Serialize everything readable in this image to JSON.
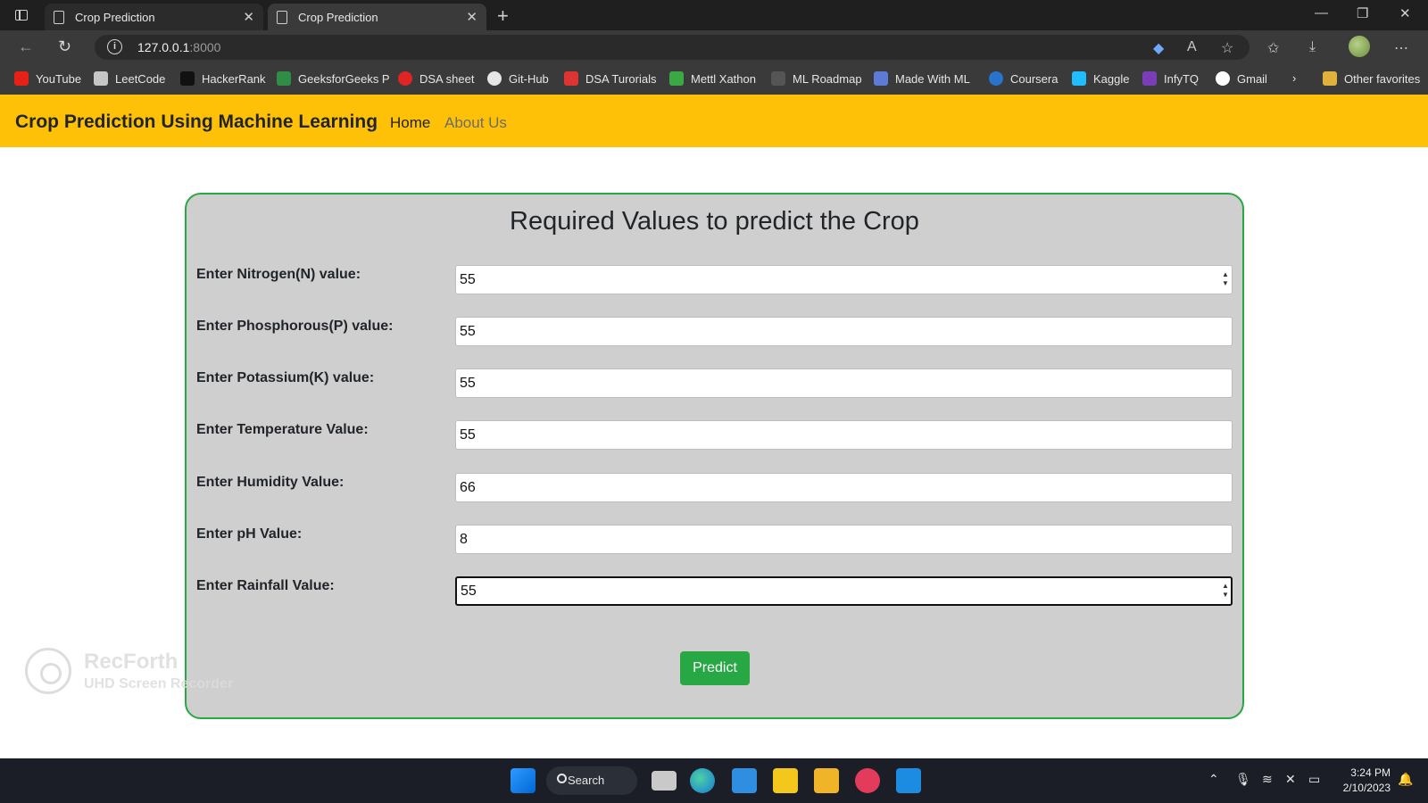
{
  "browser": {
    "tabs": [
      {
        "title": "Crop Prediction",
        "active": false
      },
      {
        "title": "Crop Prediction",
        "active": true
      }
    ],
    "url_host": "127.0.0.1",
    "url_port": ":8000",
    "bookmarks": [
      {
        "label": "YouTube",
        "icon": "youtube-icon",
        "color": "#e62117"
      },
      {
        "label": "LeetCode",
        "icon": "leetcode-icon",
        "color": "#c6c6c6"
      },
      {
        "label": "HackerRank",
        "icon": "hackerrank-icon",
        "color": "#111111"
      },
      {
        "label": "GeeksforGeeks P",
        "icon": "geeksforgeeks-icon",
        "color": "#2f8d46"
      },
      {
        "label": "DSA sheet",
        "icon": "dsa-sheet-icon",
        "color": "#e02424"
      },
      {
        "label": "Git-Hub",
        "icon": "github-icon",
        "color": "#e6e6e6"
      },
      {
        "label": "DSA Turorials",
        "icon": "dsa-tutorials-icon",
        "color": "#d33"
      },
      {
        "label": "Mettl Xathon",
        "icon": "mettl-icon",
        "color": "#39a845"
      },
      {
        "label": "ML Roadmap",
        "icon": "ml-roadmap-icon",
        "color": "#555"
      },
      {
        "label": "Made With ML",
        "icon": "made-with-ml-icon",
        "color": "#5b7bd6"
      },
      {
        "label": "Coursera",
        "icon": "coursera-icon",
        "color": "#2a73cc"
      },
      {
        "label": "Kaggle",
        "icon": "kaggle-icon",
        "color": "#20beff"
      },
      {
        "label": "InfyTQ",
        "icon": "infytq-icon",
        "color": "#7a3db8"
      },
      {
        "label": "Gmail",
        "icon": "gmail-icon",
        "color": "#ffffff"
      }
    ],
    "other_favorites": "Other favorites"
  },
  "page": {
    "brand": "Crop Prediction Using Machine Learning",
    "nav_home": "Home",
    "nav_about": "About Us",
    "form_title": "Required Values to predict the Crop",
    "fields": [
      {
        "label": "Enter Nitrogen(N) value:",
        "value": "55"
      },
      {
        "label": "Enter Phosphorous(P) value:",
        "value": "55"
      },
      {
        "label": "Enter Potassium(K) value:",
        "value": "55"
      },
      {
        "label": "Enter Temperature Value:",
        "value": "55"
      },
      {
        "label": "Enter Humidity Value:",
        "value": "66"
      },
      {
        "label": "Enter pH Value:",
        "value": "8"
      },
      {
        "label": "Enter Rainfall Value:",
        "value": "55"
      }
    ],
    "predict_label": "Predict"
  },
  "watermark": {
    "title": "RecForth",
    "subtitle": "UHD Screen Recorder"
  },
  "taskbar": {
    "search_label": "Search",
    "time": "3:24 PM",
    "date": "2/10/2023"
  },
  "colors": {
    "navbar": "#ffc107",
    "card_border": "#28a745",
    "predict_button": "#28a745"
  }
}
